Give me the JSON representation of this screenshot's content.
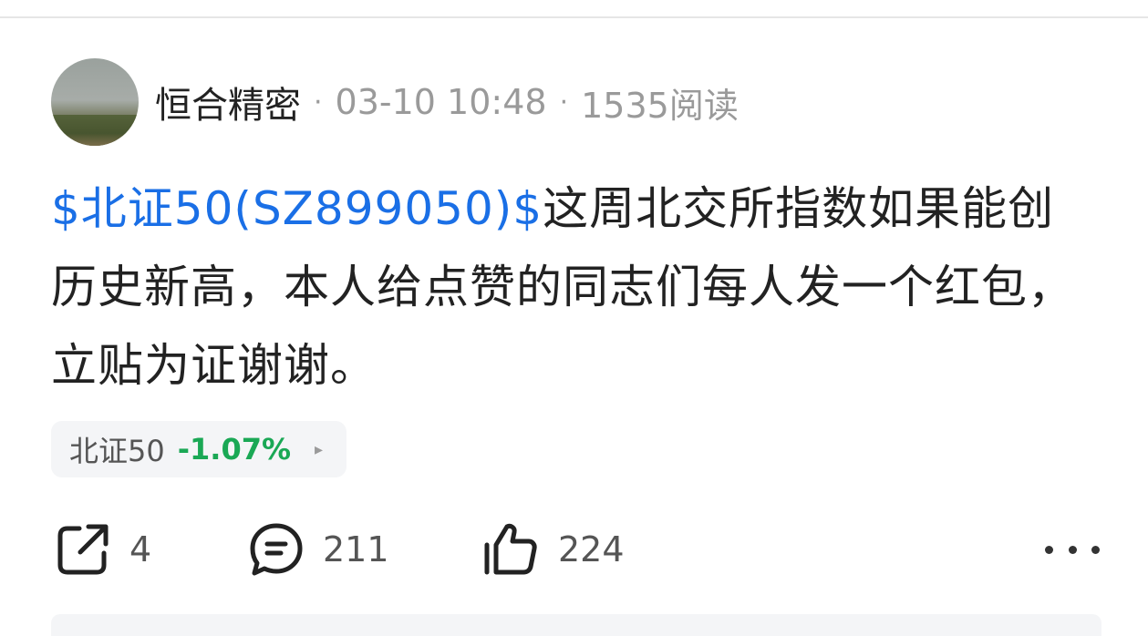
{
  "post": {
    "author": "恒合精密",
    "timestamp": "03-10 10:48",
    "read_count": "1535阅读",
    "separator": "·",
    "stock_tag": "$北证50(SZ899050)$",
    "body": "这周北交所指数如果能创历史新高，本人给点赞的同志们每人发一个红包，立贴为证谢谢。"
  },
  "quote_chip": {
    "name": "北证50",
    "change": "-1.07%",
    "change_color": "#1aa855",
    "arrow": "▸"
  },
  "actions": {
    "share_count": "4",
    "comment_count": "211",
    "like_count": "224"
  },
  "colors": {
    "link": "#1a6fe6",
    "text": "#222222",
    "muted": "#9a9a9a"
  },
  "icons": [
    "avatar-image",
    "share-icon",
    "comment-icon",
    "like-icon",
    "more-icon"
  ]
}
